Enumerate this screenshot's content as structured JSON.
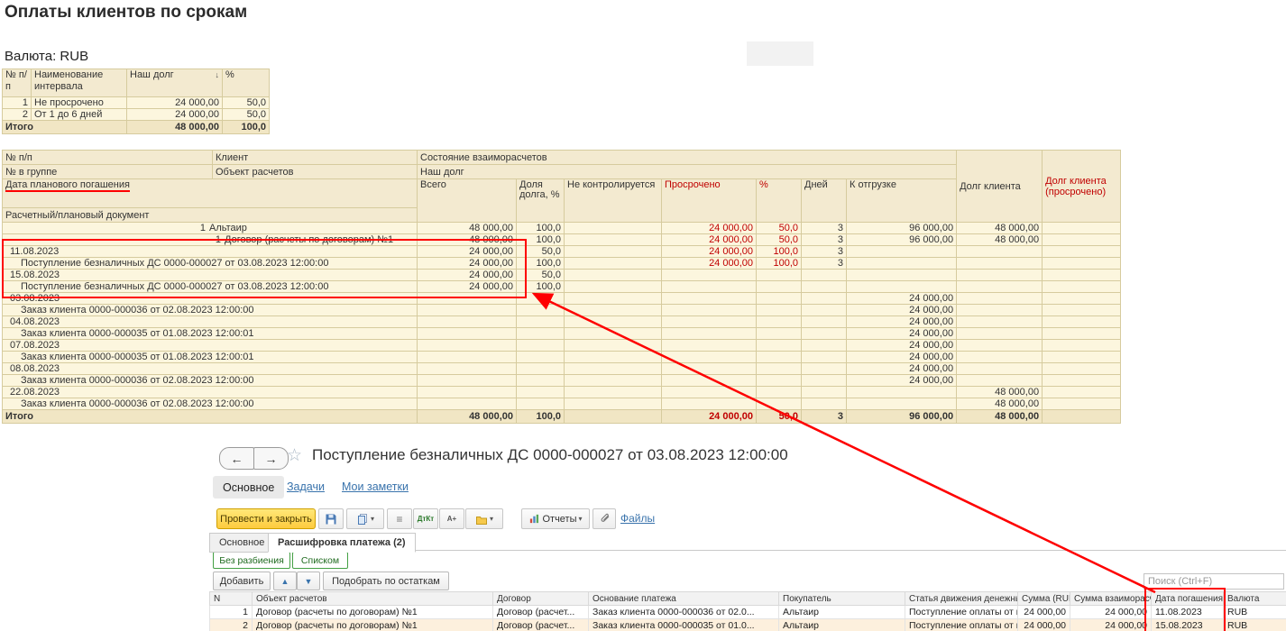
{
  "page": {
    "title": "Оплаты клиентов по срокам",
    "currency_label": "Валюта: RUB"
  },
  "colors": {
    "report_cell_bg": "#fcf6de",
    "report_header_bg": "#f3ead0",
    "report_total_bg": "#f1e6c4",
    "report_border": "#d6cb9e",
    "accent_red": "#c00000",
    "annotation_red": "#fe0000",
    "selected_row_bg": "#fdf0dd",
    "highlight_cell_bg": "#f5ad49",
    "post_button_bg": "#fecb3e",
    "link_blue": "#3973ac"
  },
  "icons": {
    "back-arrow": "←",
    "forward-arrow": "→",
    "favorite-star": "☆",
    "dropdown-caret": "▾",
    "move-up": "▲",
    "move-down": "▼",
    "sort-descending": "↓",
    "structure": "≡",
    "dt-kt": "ДтКт",
    "a-plus": "А+"
  },
  "summary_table": {
    "headers": {
      "num": "№ п/п",
      "interval": "Наименование интервала",
      "debt": "Наш долг",
      "pct": "%"
    },
    "rows": [
      {
        "num": "1",
        "interval": "Не просрочено",
        "debt": "24 000,00",
        "pct": "50,0"
      },
      {
        "num": "2",
        "interval": "От 1 до 6 дней",
        "debt": "24 000,00",
        "pct": "50,0"
      }
    ],
    "total": {
      "label": "Итого",
      "debt": "48 000,00",
      "pct": "100,0"
    }
  },
  "main_table": {
    "headers": {
      "num_pp": "№ п/п",
      "client": "Клиент",
      "state": "Состояние взаиморасчетов",
      "num_group": "№ в группе",
      "object": "Объект расчетов",
      "our_debt": "Наш долг",
      "planned_date": "Дата планового погашения",
      "doc": "Расчетный/плановый документ",
      "total": "Всего",
      "share": "Доля долга, %",
      "not_controlled": "Не контролируется",
      "overdue": "Просрочено",
      "overdue_pct": "%",
      "days": "Дней",
      "to_ship": "К отгрузке",
      "client_debt": "Долг клиента",
      "client_debt_overdue": "Долг клиента (просрочено)"
    },
    "rows": [
      {
        "type": "client",
        "num": "1",
        "label": "Альтаир",
        "total": "48 000,00",
        "share": "100,0",
        "overdue": "24 000,00",
        "overdue_pct": "50,0",
        "days": "3",
        "to_ship": "96 000,00",
        "client_debt": "48 000,00"
      },
      {
        "type": "contract",
        "num": "1",
        "label": "Договор (расчеты по договорам) №1",
        "total": "48 000,00",
        "share": "100,0",
        "overdue": "24 000,00",
        "overdue_pct": "50,0",
        "days": "3",
        "to_ship": "96 000,00",
        "client_debt": "48 000,00"
      },
      {
        "type": "date",
        "label": "11.08.2023",
        "total": "24 000,00",
        "share": "50,0",
        "overdue": "24 000,00",
        "overdue_pct": "100,0",
        "days": "3"
      },
      {
        "type": "doc",
        "label": "Поступление безналичных ДС 0000-000027 от 03.08.2023 12:00:00",
        "total": "24 000,00",
        "share": "100,0",
        "overdue": "24 000,00",
        "overdue_pct": "100,0",
        "days": "3"
      },
      {
        "type": "date",
        "label": "15.08.2023",
        "total": "24 000,00",
        "share": "50,0"
      },
      {
        "type": "doc",
        "label": "Поступление безналичных ДС 0000-000027 от 03.08.2023 12:00:00",
        "total": "24 000,00",
        "share": "100,0"
      },
      {
        "type": "date",
        "label": "03.08.2023",
        "to_ship": "24 000,00"
      },
      {
        "type": "doc",
        "label": "Заказ клиента 0000-000036 от 02.08.2023 12:00:00",
        "to_ship": "24 000,00"
      },
      {
        "type": "date",
        "label": "04.08.2023",
        "to_ship": "24 000,00"
      },
      {
        "type": "doc",
        "label": "Заказ клиента 0000-000035 от 01.08.2023 12:00:01",
        "to_ship": "24 000,00"
      },
      {
        "type": "date",
        "label": "07.08.2023",
        "to_ship": "24 000,00"
      },
      {
        "type": "doc",
        "label": "Заказ клиента 0000-000035 от 01.08.2023 12:00:01",
        "to_ship": "24 000,00"
      },
      {
        "type": "date",
        "label": "08.08.2023",
        "to_ship": "24 000,00"
      },
      {
        "type": "doc",
        "label": "Заказ клиента 0000-000036 от 02.08.2023 12:00:00",
        "to_ship": "24 000,00"
      },
      {
        "type": "date",
        "label": "22.08.2023",
        "client_debt": "48 000,00"
      },
      {
        "type": "doc",
        "label": "Заказ клиента 0000-000036 от 02.08.2023 12:00:00",
        "client_debt": "48 000,00"
      }
    ],
    "total_row": {
      "label": "Итого",
      "total": "48 000,00",
      "share": "100,0",
      "overdue": "24 000,00",
      "overdue_pct": "50,0",
      "days": "3",
      "to_ship": "96 000,00",
      "client_debt": "48 000,00"
    }
  },
  "document_window": {
    "title": "Поступление безналичных ДС 0000-000027 от 03.08.2023 12:00:00",
    "nav_tabs": [
      "Основное",
      "Задачи",
      "Мои заметки"
    ],
    "toolbar": {
      "post_close": "Провести и закрыть",
      "reports": "Отчеты",
      "files": "Файлы"
    },
    "tabs": [
      "Основное",
      "Расшифровка платежа (2)"
    ],
    "view_buttons": [
      "Без разбиения",
      "Списком"
    ],
    "commands": {
      "add": "Добавить",
      "pick": "Подобрать по остаткам"
    },
    "search_placeholder": "Поиск (Ctrl+F)",
    "payment_table": {
      "headers": [
        "N",
        "Объект расчетов",
        "Договор",
        "Основание платежа",
        "Покупатель",
        "Статья движения денежных ...",
        "Сумма (RUB)",
        "Сумма взаиморасчетов",
        "Дата погашения",
        "Валюта"
      ],
      "rows": [
        [
          "1",
          "Договор (расчеты по договорам) №1",
          "Договор (расчет...",
          "Заказ клиента 0000-000036 от 02.0...",
          "Альтаир",
          "Поступление оплаты от клие...",
          "24 000,00",
          "24 000,00",
          "11.08.2023",
          "RUB"
        ],
        [
          "2",
          "Договор (расчеты по договорам) №1",
          "Договор (расчет...",
          "Заказ клиента 0000-000035 от 01.0...",
          "Альтаир",
          "Поступление оплаты от клие...",
          "24 000,00",
          "24 000,00",
          "15.08.2023",
          "RUB"
        ]
      ]
    }
  }
}
